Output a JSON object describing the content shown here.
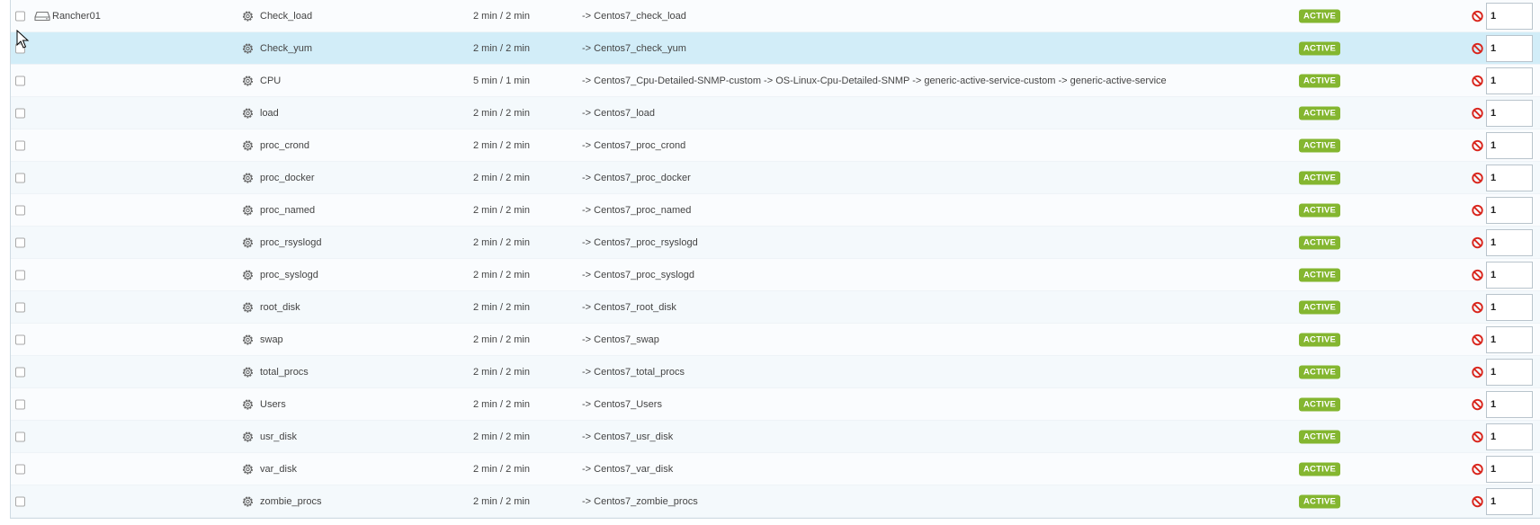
{
  "host": {
    "name": "Rancher01",
    "icon": "hard-drive-icon"
  },
  "status_color": "#84b630",
  "disable_color": "#d9251c",
  "services": [
    {
      "name": "Check_load",
      "interval": "2 min / 2 min",
      "template": "-> Centos7_check_load",
      "status": "ACTIVE",
      "duplicates": "1"
    },
    {
      "name": "Check_yum",
      "interval": "2 min / 2 min",
      "template": "-> Centos7_check_yum",
      "status": "ACTIVE",
      "duplicates": "1"
    },
    {
      "name": "CPU",
      "interval": "5 min / 1 min",
      "template": "-> Centos7_Cpu-Detailed-SNMP-custom -> OS-Linux-Cpu-Detailed-SNMP -> generic-active-service-custom -> generic-active-service",
      "status": "ACTIVE",
      "duplicates": "1"
    },
    {
      "name": "load",
      "interval": "2 min / 2 min",
      "template": "-> Centos7_load",
      "status": "ACTIVE",
      "duplicates": "1"
    },
    {
      "name": "proc_crond",
      "interval": "2 min / 2 min",
      "template": "-> Centos7_proc_crond",
      "status": "ACTIVE",
      "duplicates": "1"
    },
    {
      "name": "proc_docker",
      "interval": "2 min / 2 min",
      "template": "-> Centos7_proc_docker",
      "status": "ACTIVE",
      "duplicates": "1"
    },
    {
      "name": "proc_named",
      "interval": "2 min / 2 min",
      "template": "-> Centos7_proc_named",
      "status": "ACTIVE",
      "duplicates": "1"
    },
    {
      "name": "proc_rsyslogd",
      "interval": "2 min / 2 min",
      "template": "-> Centos7_proc_rsyslogd",
      "status": "ACTIVE",
      "duplicates": "1"
    },
    {
      "name": "proc_syslogd",
      "interval": "2 min / 2 min",
      "template": "-> Centos7_proc_syslogd",
      "status": "ACTIVE",
      "duplicates": "1"
    },
    {
      "name": "root_disk",
      "interval": "2 min / 2 min",
      "template": "-> Centos7_root_disk",
      "status": "ACTIVE",
      "duplicates": "1"
    },
    {
      "name": "swap",
      "interval": "2 min / 2 min",
      "template": "-> Centos7_swap",
      "status": "ACTIVE",
      "duplicates": "1"
    },
    {
      "name": "total_procs",
      "interval": "2 min / 2 min",
      "template": "-> Centos7_total_procs",
      "status": "ACTIVE",
      "duplicates": "1"
    },
    {
      "name": "Users",
      "interval": "2 min / 2 min",
      "template": "-> Centos7_Users",
      "status": "ACTIVE",
      "duplicates": "1"
    },
    {
      "name": "usr_disk",
      "interval": "2 min / 2 min",
      "template": "-> Centos7_usr_disk",
      "status": "ACTIVE",
      "duplicates": "1"
    },
    {
      "name": "var_disk",
      "interval": "2 min / 2 min",
      "template": "-> Centos7_var_disk",
      "status": "ACTIVE",
      "duplicates": "1"
    },
    {
      "name": "zombie_procs",
      "interval": "2 min / 2 min",
      "template": "-> Centos7_zombie_procs",
      "status": "ACTIVE",
      "duplicates": "1"
    }
  ]
}
